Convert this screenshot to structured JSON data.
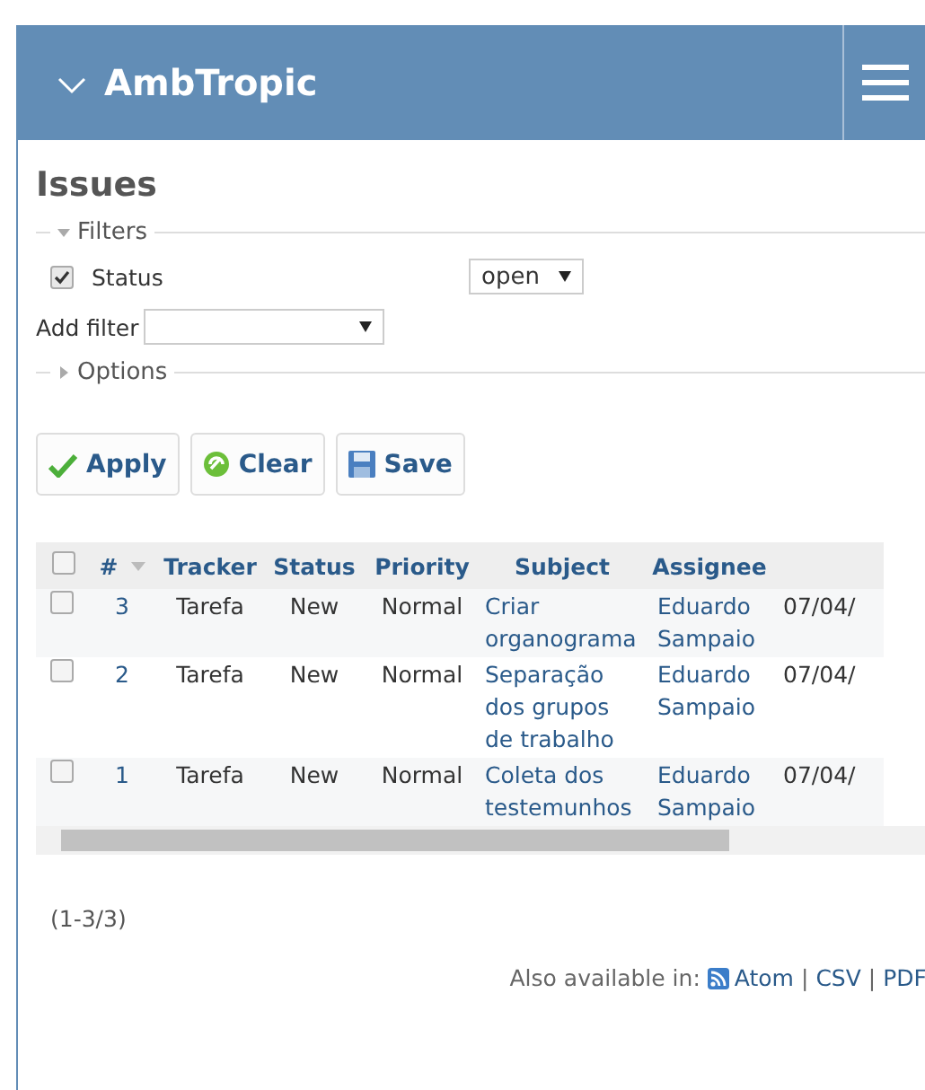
{
  "header": {
    "title": "AmbTropic"
  },
  "page_title": "Issues",
  "filters": {
    "legend": "Filters",
    "expanded": true,
    "rows": [
      {
        "label": "Status",
        "checked": true,
        "value": "open"
      }
    ],
    "add_filter": {
      "label": "Add filter"
    }
  },
  "options": {
    "legend": "Options",
    "expanded": false
  },
  "buttons": [
    {
      "kind": "apply",
      "label": "Apply"
    },
    {
      "kind": "clear",
      "label": "Clear"
    },
    {
      "kind": "save",
      "label": "Save"
    }
  ],
  "table": {
    "all_checked": false,
    "columns": [
      {
        "label": "#",
        "sorted": true
      },
      {
        "label": "Tracker",
        "sorted": false
      },
      {
        "label": "Status",
        "sorted": false
      },
      {
        "label": "Priority",
        "sorted": false
      },
      {
        "label": "Subject",
        "sorted": false
      },
      {
        "label": "Assignee",
        "sorted": false
      }
    ],
    "rows": [
      {
        "checked": false,
        "id": "3",
        "tracker": "Tarefa",
        "status": "New",
        "priority": "Normal",
        "subject": "Criar organograma",
        "assignee": "Eduardo Sampaio",
        "column_8": "07/04/"
      },
      {
        "checked": false,
        "id": "2",
        "tracker": "Tarefa",
        "status": "New",
        "priority": "Normal",
        "subject": "Separação dos grupos de trabalho",
        "assignee": "Eduardo Sampaio",
        "column_8": "07/04/"
      },
      {
        "checked": false,
        "id": "1",
        "tracker": "Tarefa",
        "status": "New",
        "priority": "Normal",
        "subject": "Coleta dos testemunhos",
        "assignee": "Eduardo Sampaio",
        "column_8": "07/04/"
      }
    ]
  },
  "pagination": "(1-3/3)",
  "other_formats": {
    "label": "Also available in:",
    "separator": "|",
    "links": [
      {
        "kind": "atom",
        "label": "Atom"
      },
      {
        "kind": "plain",
        "label": "CSV"
      },
      {
        "kind": "plain",
        "label": "PDF"
      }
    ]
  }
}
